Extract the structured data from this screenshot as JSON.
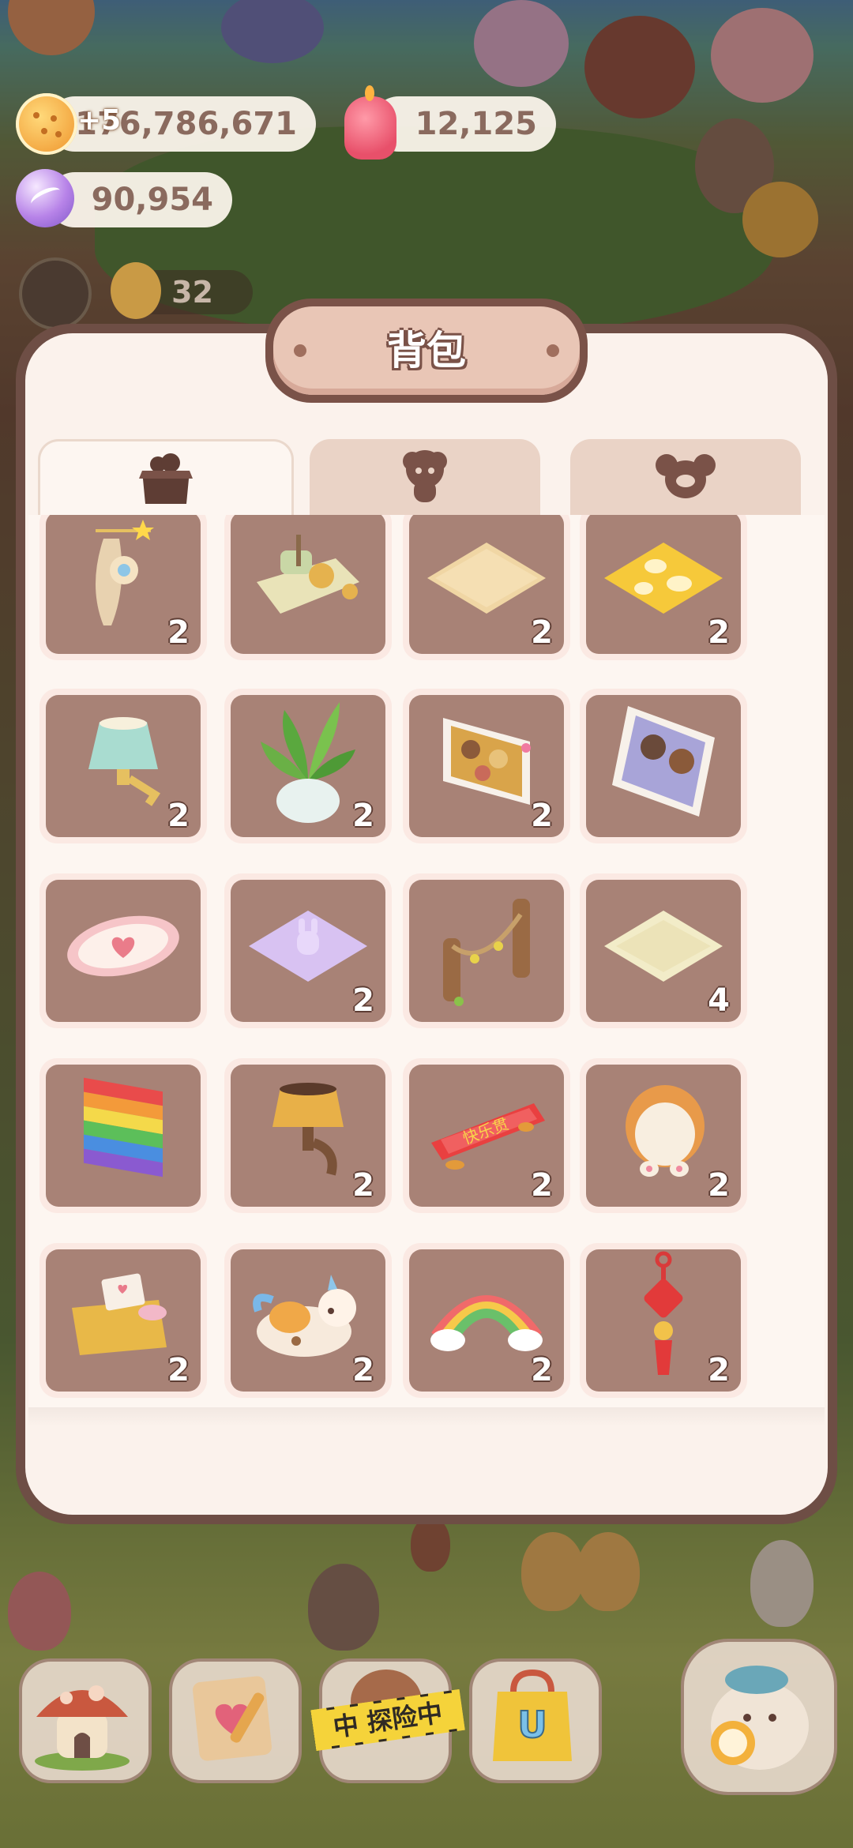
{
  "currencies": {
    "coins": {
      "value": "176,786,671",
      "bonus": "+5",
      "icon": "cookie-coin-icon"
    },
    "jelly": {
      "value": "12,125",
      "icon": "jelly-icon"
    },
    "crystals": {
      "value": "90,954",
      "icon": "crystal-icon"
    },
    "cookies": {
      "value": "32",
      "icon": "cookie-head-icon"
    }
  },
  "panel": {
    "title": "背包",
    "tabs": [
      {
        "icon": "box-icon",
        "active": true
      },
      {
        "icon": "cookie-silhouette-icon",
        "active": false
      },
      {
        "icon": "pet-silhouette-icon",
        "active": false
      }
    ]
  },
  "items": [
    {
      "name": "wall-rope-cookie-decoration",
      "count": "2"
    },
    {
      "name": "pottery-wheel-table",
      "count": ""
    },
    {
      "name": "cracker-floor-tile",
      "count": "2"
    },
    {
      "name": "giraffe-pattern-floor-tile",
      "count": "2"
    },
    {
      "name": "teal-wall-lamp",
      "count": "2"
    },
    {
      "name": "potted-green-plant",
      "count": "2"
    },
    {
      "name": "cookie-group-photo-frame",
      "count": "2"
    },
    {
      "name": "couple-photo-frame",
      "count": ""
    },
    {
      "name": "heart-rug",
      "count": ""
    },
    {
      "name": "bunny-purple-rug",
      "count": "2"
    },
    {
      "name": "wooden-rope-fence",
      "count": ""
    },
    {
      "name": "cream-floor-tile",
      "count": "4"
    },
    {
      "name": "rainbow-flag",
      "count": ""
    },
    {
      "name": "amber-wall-lamp",
      "count": "2"
    },
    {
      "name": "red-couplet-banner",
      "count": "2"
    },
    {
      "name": "corgi-cushion",
      "count": "2"
    },
    {
      "name": "picnic-basket",
      "count": "2"
    },
    {
      "name": "unicorn-cow-plush",
      "count": "2"
    },
    {
      "name": "rainbow-cloud-decoration",
      "count": "2"
    },
    {
      "name": "chinese-knot-ornament",
      "count": "2"
    }
  ],
  "bottom_bar": {
    "buttons": [
      {
        "icon": "mushroom-house-icon"
      },
      {
        "icon": "heart-notebook-icon"
      },
      {
        "icon": "exploring-icon",
        "label": "中 探险中"
      },
      {
        "icon": "shop-bag-icon"
      },
      {
        "icon": "fish-cat-clock-icon"
      }
    ]
  },
  "colors": {
    "panel_frame": "#6e4e45",
    "panel_bg": "#fbf2ec",
    "cell_bg": "#a88276",
    "title_plate": "#e9c6b6"
  }
}
